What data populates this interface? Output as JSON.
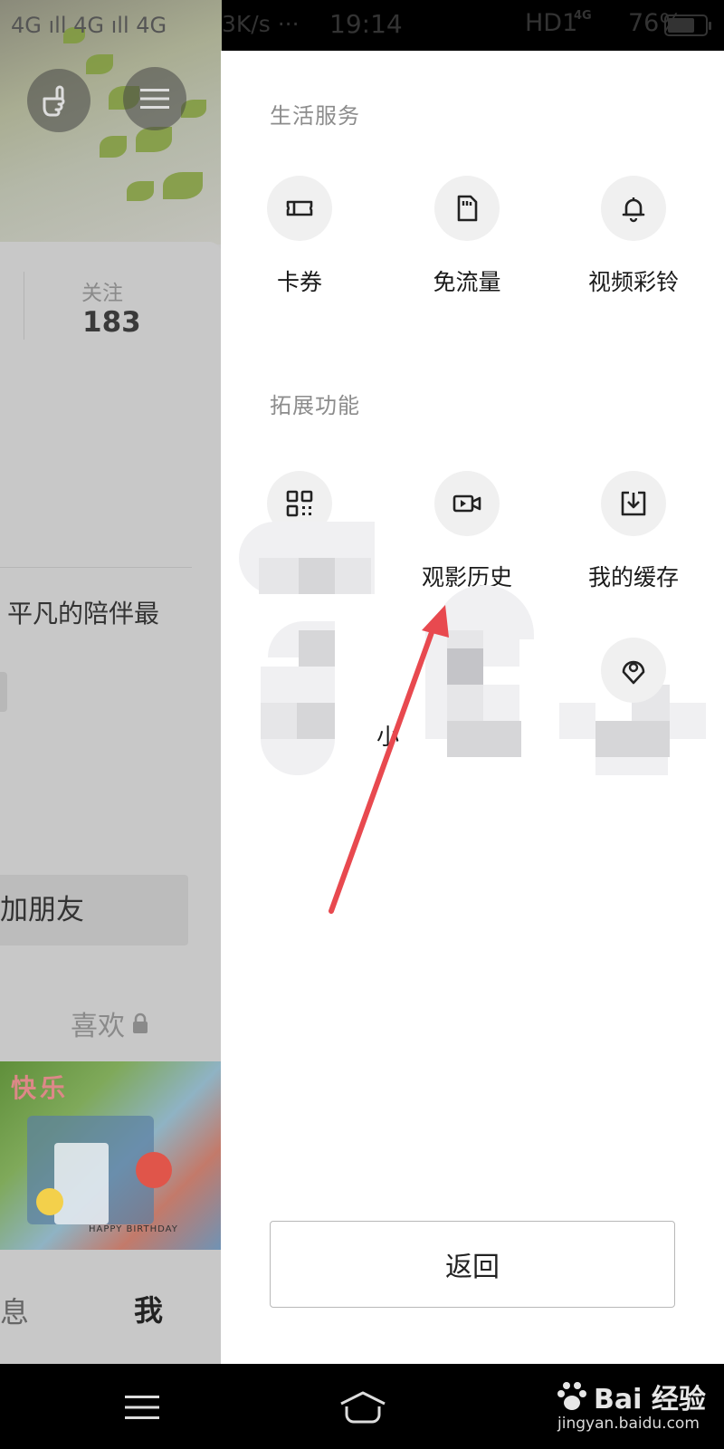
{
  "status_bar": {
    "network": "4G ıll 4G ıll 4G",
    "speed": "3K/s ···",
    "time": "19:14",
    "hd": "HD1",
    "lte": "4G",
    "battery_percent": "76%",
    "battery_level": 0.76
  },
  "profile": {
    "follow_label": "关注",
    "follow_count": "183",
    "motto": "平凡的陪伴最",
    "add_friend": "加朋友",
    "likes_tab": "喜欢",
    "photo_text": "快乐",
    "photo_caption": "HAPPY BIRTHDAY",
    "bottom_tabs": {
      "messages": "息",
      "me": "我"
    }
  },
  "menu": {
    "life_services": {
      "title": "生活服务",
      "items": [
        {
          "label": "卡券",
          "icon": "ticket-icon"
        },
        {
          "label": "免流量",
          "icon": "sim-card-icon"
        },
        {
          "label": "视频彩铃",
          "icon": "bell-icon"
        }
      ]
    },
    "extended": {
      "title": "拓展功能",
      "items": [
        {
          "label": "",
          "icon": "qr-code-icon"
        },
        {
          "label": "观影历史",
          "icon": "video-camera-icon"
        },
        {
          "label": "我的缓存",
          "icon": "download-icon"
        },
        {
          "label": "",
          "icon": "blurred-icon"
        },
        {
          "label": "小",
          "icon": "blurred-icon"
        },
        {
          "label": "",
          "icon": "location-icon"
        }
      ]
    },
    "back_button": "返回"
  },
  "annotation": {
    "color": "#e8494f"
  },
  "watermark": {
    "brand": "Bai 经验",
    "url": "jingyan.baidu.com"
  }
}
